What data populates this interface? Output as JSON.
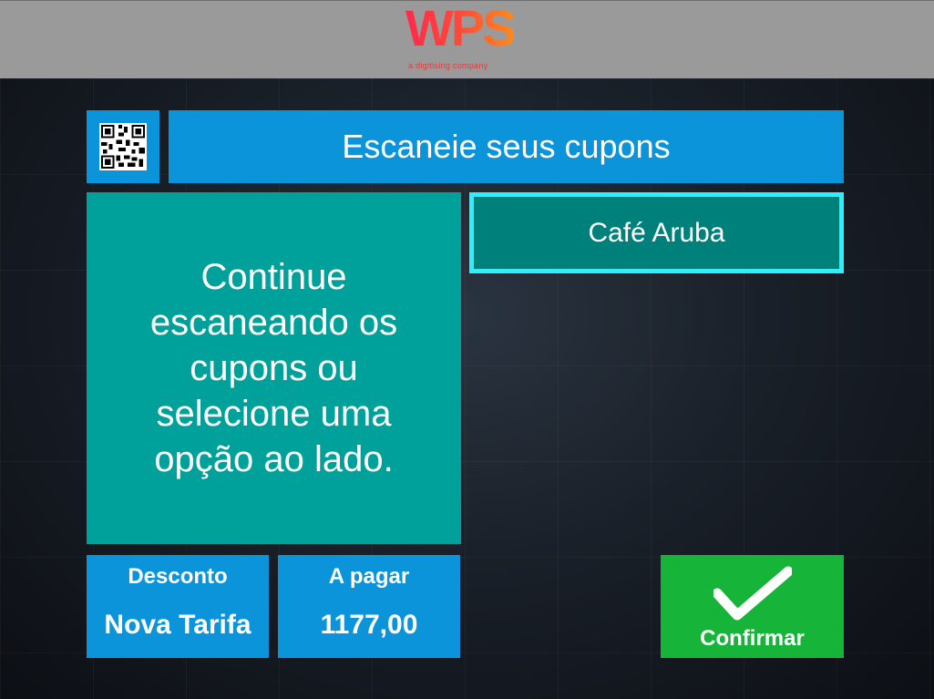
{
  "header": {
    "logo_text": "WPS",
    "logo_tagline": "a digitising company"
  },
  "title": {
    "icon": "qr-code-icon",
    "text": "Escaneie seus cupons"
  },
  "message": {
    "text": "Continue escaneando os cupons ou selecione uma opção ao lado."
  },
  "options": [
    {
      "label": "Café Aruba",
      "selected": true
    }
  ],
  "discount": {
    "label": "Desconto",
    "value": "Nova Tarifa"
  },
  "payment": {
    "label": "A pagar",
    "value": "1177,00"
  },
  "confirm": {
    "icon": "checkmark-icon",
    "label": "Confirmar"
  },
  "colors": {
    "header_bg": "#9a9a9a",
    "panel_blue": "#0b94da",
    "panel_teal": "#00a19a",
    "option_bg": "#00807a",
    "option_border": "#2df0ff",
    "confirm_green": "#17b43a"
  }
}
